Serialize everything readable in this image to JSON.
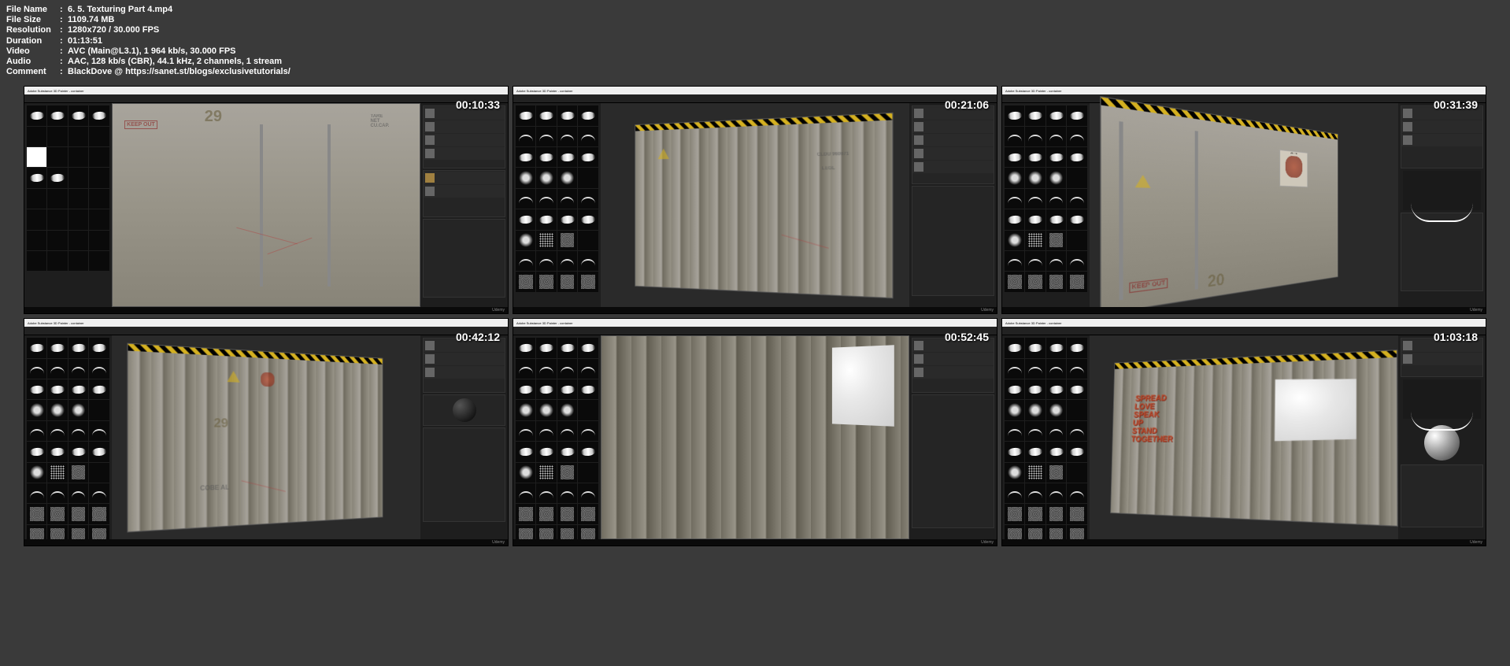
{
  "metadata": {
    "filename_label": "File Name",
    "filename": "6. 5. Texturing Part 4.mp4",
    "filesize_label": "File Size",
    "filesize": "1109.74 MB",
    "resolution_label": "Resolution",
    "resolution": "1280x720 / 30.000 FPS",
    "duration_label": "Duration",
    "duration": "01:13:51",
    "video_label": "Video",
    "video": "AVC (Main@L3.1), 1 964 kb/s, 30.000 FPS",
    "audio_label": "Audio",
    "audio": "AAC, 128 kb/s (CBR), 44.1 kHz, 2 channels, 1 stream",
    "comment_label": "Comment",
    "comment": "BlackDove @ https://sanet.st/blogs/exclusivetutorials/"
  },
  "app_title": "Adobe Substance 3D Painter - container",
  "watermark": "Udemy",
  "thumbnails": [
    {
      "timestamp": "00:10:33",
      "decals": {
        "keepout": "KEEP OUT",
        "number": "29",
        "tare": "TARE\nNET\nCU.CAP."
      }
    },
    {
      "timestamp": "00:21:06",
      "decals": {
        "code": "CLDU   960671",
        "legl": "LEGL"
      }
    },
    {
      "timestamp": "00:31:39",
      "decals": {
        "area51": "AREA 51",
        "keepout": "KEEP OUT",
        "number": "20"
      }
    },
    {
      "timestamp": "00:42:12",
      "decals": {
        "number": "29",
        "cobe": "COBE   AL"
      }
    },
    {
      "timestamp": "00:52:45"
    },
    {
      "timestamp": "01:03:18",
      "graffiti": [
        "SPREAD",
        "LOVE",
        "SPEAK",
        "UP",
        "STAND",
        "TOGETHER"
      ]
    }
  ]
}
